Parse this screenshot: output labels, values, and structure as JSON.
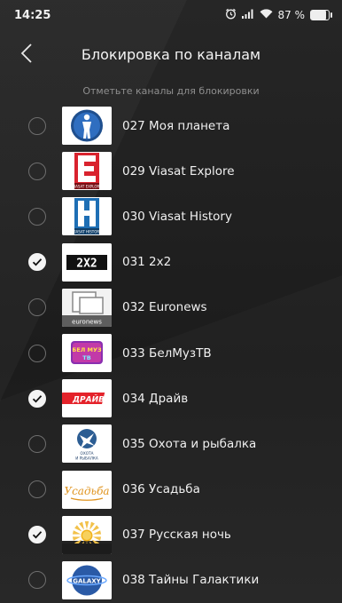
{
  "status_bar": {
    "time": "14:25",
    "battery_label": "87 %",
    "battery_level": 0.87,
    "icons": [
      "alarm-icon",
      "signal-icon",
      "wifi-icon",
      "battery-icon"
    ]
  },
  "header": {
    "title": "Блокировка по каналам",
    "back_icon": "chevron-left-icon"
  },
  "hint": "Отметьте каналы для блокировки",
  "colors": {
    "background": "#1e1e1e",
    "check_fill": "#f4f4f4",
    "check_border": "#6e6e6e",
    "text": "#f0f0f0",
    "hint": "#8f8f8f"
  },
  "channels": [
    {
      "label": "027 Моя планета",
      "checked": false,
      "logo": "moya-planeta-logo"
    },
    {
      "label": "029 Viasat Explore",
      "checked": false,
      "logo": "viasat-explore-logo",
      "logo_text": "VIASAT EXPLORE"
    },
    {
      "label": "030 Viasat History",
      "checked": false,
      "logo": "viasat-history-logo",
      "logo_text": "VIASAT HISTORY"
    },
    {
      "label": "031 2x2",
      "checked": true,
      "logo": "2x2-logo",
      "logo_text": "2X2"
    },
    {
      "label": "032 Euronews",
      "checked": false,
      "logo": "euronews-logo",
      "logo_text": "euronews"
    },
    {
      "label": "033 БелМузТВ",
      "checked": false,
      "logo": "belmuztv-logo",
      "logo_text": "БЕЛ МУЗ ТВ"
    },
    {
      "label": "034 Драйв",
      "checked": true,
      "logo": "drive-logo",
      "logo_text": "ДРАЙВ"
    },
    {
      "label": "035 Охота и рыбалка",
      "checked": false,
      "logo": "okhota-rybalka-logo",
      "logo_text": "ОХОТА И РЫБАЛКА"
    },
    {
      "label": "036 Усадьба",
      "checked": false,
      "logo": "usadba-logo",
      "logo_text": "Усадьба"
    },
    {
      "label": "037 Русская ночь",
      "checked": true,
      "logo": "russkaya-noch-logo"
    },
    {
      "label": "038 Тайны Галактики",
      "checked": false,
      "logo": "tayny-galaktiki-logo",
      "logo_text": "GALAXY"
    }
  ]
}
